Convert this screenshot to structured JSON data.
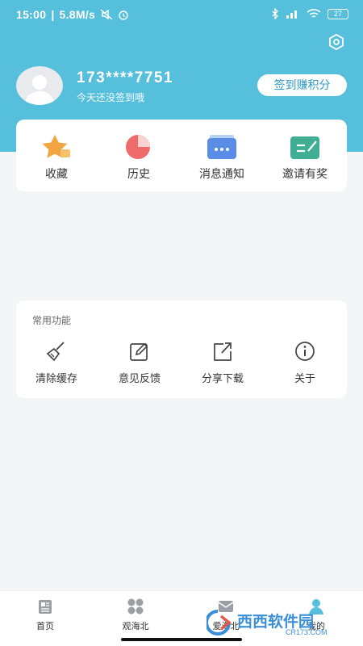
{
  "status_bar": {
    "time": "15:00",
    "speed": "5.8M/s",
    "battery": "27"
  },
  "profile": {
    "phone": "173****7751",
    "hint": "今天还没签到哦",
    "checkin_label": "签到赚积分"
  },
  "quick_items": [
    {
      "label": "收藏",
      "icon": "star-icon"
    },
    {
      "label": "历史",
      "icon": "pie-chart-icon"
    },
    {
      "label": "消息通知",
      "icon": "message-icon"
    },
    {
      "label": "邀请有奖",
      "icon": "invite-icon"
    }
  ],
  "functions": {
    "title": "常用功能",
    "items": [
      {
        "label": "清除缓存",
        "icon": "broom-icon"
      },
      {
        "label": "意见反馈",
        "icon": "edit-icon"
      },
      {
        "label": "分享下载",
        "icon": "share-icon"
      },
      {
        "label": "关于",
        "icon": "info-icon"
      }
    ]
  },
  "tabs": [
    {
      "label": "首页",
      "icon": "home-news-icon"
    },
    {
      "label": "观海北",
      "icon": "grid-icon"
    },
    {
      "label": "爱海北",
      "icon": "mail-icon"
    },
    {
      "label": "我的",
      "icon": "profile-icon"
    }
  ],
  "watermark": {
    "text": "西西软件园",
    "sub": "CR173.COM"
  },
  "colors": {
    "accent": "#56bfdc",
    "checkin_text": "#2e9ac8"
  }
}
